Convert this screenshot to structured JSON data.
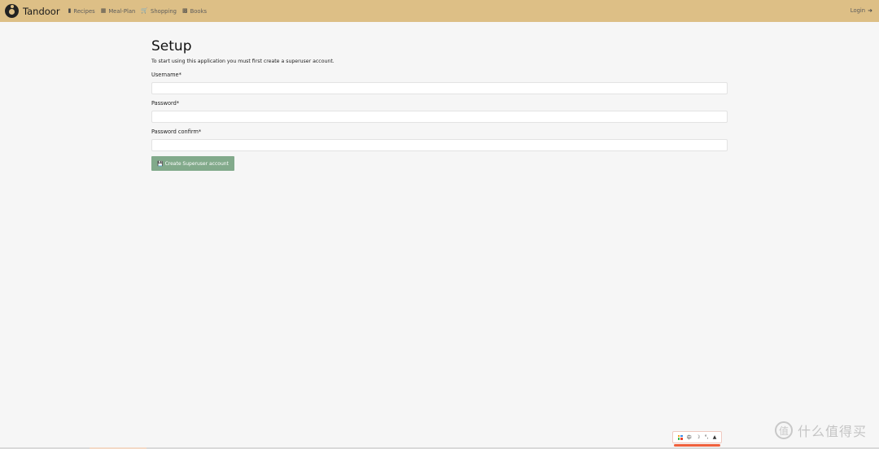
{
  "navbar": {
    "brand": "Tandoor",
    "items": [
      {
        "label": "Recipes",
        "icon": "book-icon"
      },
      {
        "label": "Meal-Plan",
        "icon": "calendar-icon"
      },
      {
        "label": "Shopping",
        "icon": "cart-icon"
      },
      {
        "label": "Books",
        "icon": "open-book-icon"
      }
    ],
    "login_label": "Login",
    "background": "#ddbf86"
  },
  "setup": {
    "title": "Setup",
    "intro": "To start using this application you must first create a superuser account.",
    "fields": [
      {
        "label": "Username*",
        "value": ""
      },
      {
        "label": "Password*",
        "value": ""
      },
      {
        "label": "Password confirm*",
        "value": ""
      }
    ],
    "submit_label": "Create Superuser account",
    "submit_color": "#82aa8b"
  },
  "ime_toolbar": {
    "items": [
      "grid-icon",
      "中",
      "moon-icon",
      "punctuation-icon",
      "shirt-icon"
    ]
  },
  "watermark": {
    "badge": "值",
    "text": "什么值得买"
  }
}
